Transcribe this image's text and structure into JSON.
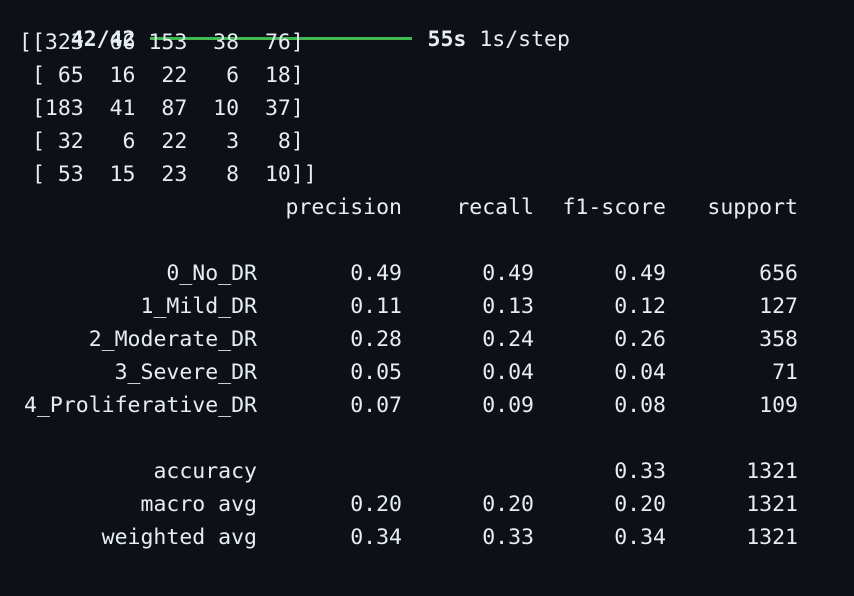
{
  "progress": {
    "steps": "42/42",
    "fraction": 1.0,
    "time": "55s",
    "rate": "1s/step",
    "bar_color": "#3fb950"
  },
  "confusion_matrix": [
    "[[323  66 153  38  76]",
    " [ 65  16  22   6  18]",
    " [183  41  87  10  37]",
    " [ 32   6  22   3   8]",
    " [ 53  15  23   8  10]]"
  ],
  "report": {
    "headers": [
      "precision",
      "recall",
      "f1-score",
      "support"
    ],
    "rows": [
      {
        "label": "0_No_DR",
        "precision": "0.49",
        "recall": "0.49",
        "f1": "0.49",
        "support": "656"
      },
      {
        "label": "1_Mild_DR",
        "precision": "0.11",
        "recall": "0.13",
        "f1": "0.12",
        "support": "127"
      },
      {
        "label": "2_Moderate_DR",
        "precision": "0.28",
        "recall": "0.24",
        "f1": "0.26",
        "support": "358"
      },
      {
        "label": "3_Severe_DR",
        "precision": "0.05",
        "recall": "0.04",
        "f1": "0.04",
        "support": "71"
      },
      {
        "label": "4_Proliferative_DR",
        "precision": "0.07",
        "recall": "0.09",
        "f1": "0.08",
        "support": "109"
      }
    ],
    "summary": [
      {
        "label": "accuracy",
        "precision": "",
        "recall": "",
        "f1": "0.33",
        "support": "1321"
      },
      {
        "label": "macro avg",
        "precision": "0.20",
        "recall": "0.20",
        "f1": "0.20",
        "support": "1321"
      },
      {
        "label": "weighted avg",
        "precision": "0.34",
        "recall": "0.33",
        "f1": "0.34",
        "support": "1321"
      }
    ]
  }
}
